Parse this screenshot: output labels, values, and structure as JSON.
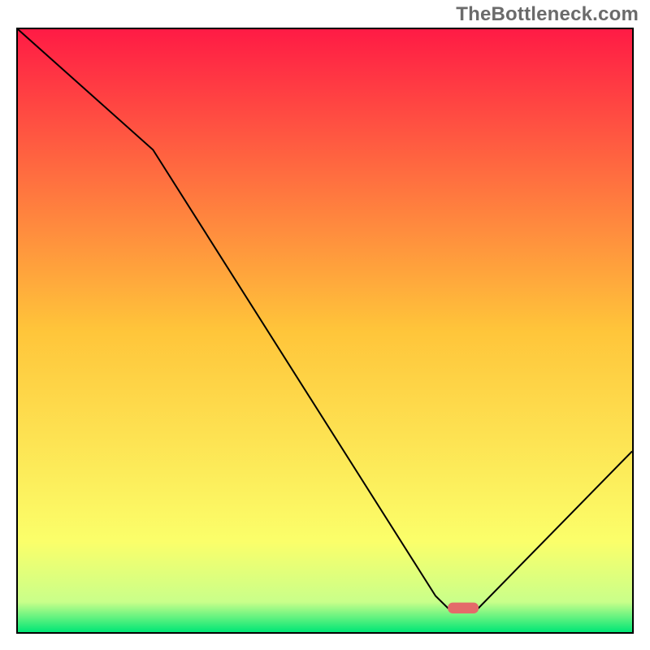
{
  "watermark": "TheBottleneck.com",
  "chart_data": {
    "type": "line",
    "title": "",
    "xlabel": "",
    "ylabel": "",
    "xlim": [
      0,
      100
    ],
    "ylim": [
      0,
      100
    ],
    "grid": false,
    "x": [
      0,
      22,
      68,
      70,
      75,
      100
    ],
    "values": [
      100,
      80,
      6,
      4,
      4,
      30
    ],
    "highlight_segment": {
      "x_start": 70,
      "x_end": 75,
      "y": 4
    },
    "background": {
      "type": "vertical-gradient",
      "stops": [
        {
          "offset": 0.0,
          "color": "#ff1b45"
        },
        {
          "offset": 0.5,
          "color": "#ffc53a"
        },
        {
          "offset": 0.85,
          "color": "#fbff6a"
        },
        {
          "offset": 0.95,
          "color": "#c9ff8a"
        },
        {
          "offset": 1.0,
          "color": "#00e676"
        }
      ]
    },
    "colors": {
      "curve": "#000000",
      "highlight": "#e46a6a"
    }
  }
}
